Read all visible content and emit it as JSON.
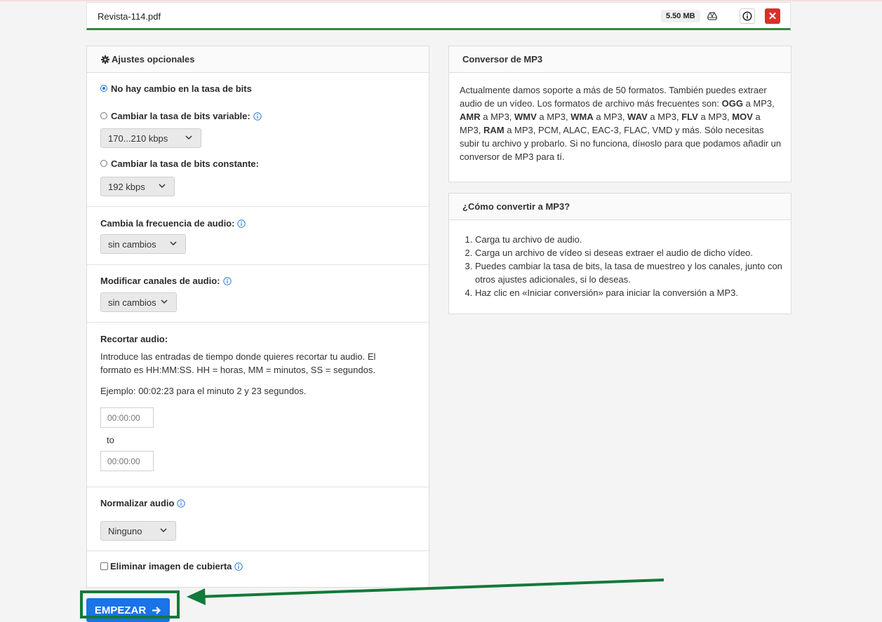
{
  "file": {
    "name": "Revista-114.pdf",
    "size": "5.50 MB"
  },
  "settings": {
    "title": "Ajustes opcionales",
    "bitrate": {
      "no_change": "No hay cambio en la tasa de bits",
      "variable_label": "Cambiar la tasa de bits variable:",
      "variable_value": "170...210 kbps",
      "constant_label": "Cambiar la tasa de bits constante:",
      "constant_value": "192 kbps"
    },
    "frequency": {
      "label": "Cambia la frecuencia de audio:",
      "value": "sin cambios"
    },
    "channels": {
      "label": "Modificar canales de audio:",
      "value": "sin cambios"
    },
    "trim": {
      "label": "Recortar audio:",
      "description": "Introduce las entradas de tiempo donde quieres recortar tu audio. El formato es HH:MM:SS. HH = horas, MM = minutos, SS = segundos.",
      "example": "Ejemplo: 00:02:23 para el minuto 2 y 23 segundos.",
      "from_placeholder": "00:00:00",
      "to_label": "to",
      "to_placeholder": "00:00:00"
    },
    "normalize": {
      "label": "Normalizar audio",
      "value": "Ninguno"
    },
    "cover": {
      "label": "Eliminar imagen de cubierta"
    }
  },
  "converter": {
    "title": "Conversor de MP3",
    "p1": "Actualmente damos soporte a más de 50 formatos. También puedes extraer audio de un vídeo. Los formatos de archivo más frecuentes son: ",
    "f1": "OGG",
    "t1": " a MP3, ",
    "f2": "AMR",
    "t2": " a MP3, ",
    "f3": "WMV",
    "t3": " a MP3, ",
    "f4": "WMA",
    "t4": " a MP3, ",
    "f5": "WAV",
    "t5": " a MP3, ",
    "f6": "FLV",
    "t6": " a MP3, ",
    "f7": "MOV",
    "t7": " a MP3, ",
    "f8": "RAM",
    "t8": " a MP3, PCM, ALAC, EAC-3, FLAC, VMD y más. Sólo necesitas subir tu archivo y probarlo. Si no funciona, díноslo para que podamos añadir un conversor de MP3 para tí."
  },
  "howto": {
    "title": "¿Cómo convertir a MP3?",
    "steps": [
      "Carga tu archivo de audio.",
      "Carga un archivo de vídeo si deseas extraer el audio de dicho vídeo.",
      "Puedes cambiar la tasa de bits, la tasa de muestreo y los canales, junto con otros ajustes adicionales, si lo deseas.",
      "Haz clic en «Iniciar conversión» para iniciar la conversión a MP3."
    ]
  },
  "start_button": "EMPEZAR",
  "colors": {
    "accent": "#1a73e8",
    "highlight": "#127a38",
    "close": "#d9302c",
    "progress": "#2e8b3e"
  }
}
